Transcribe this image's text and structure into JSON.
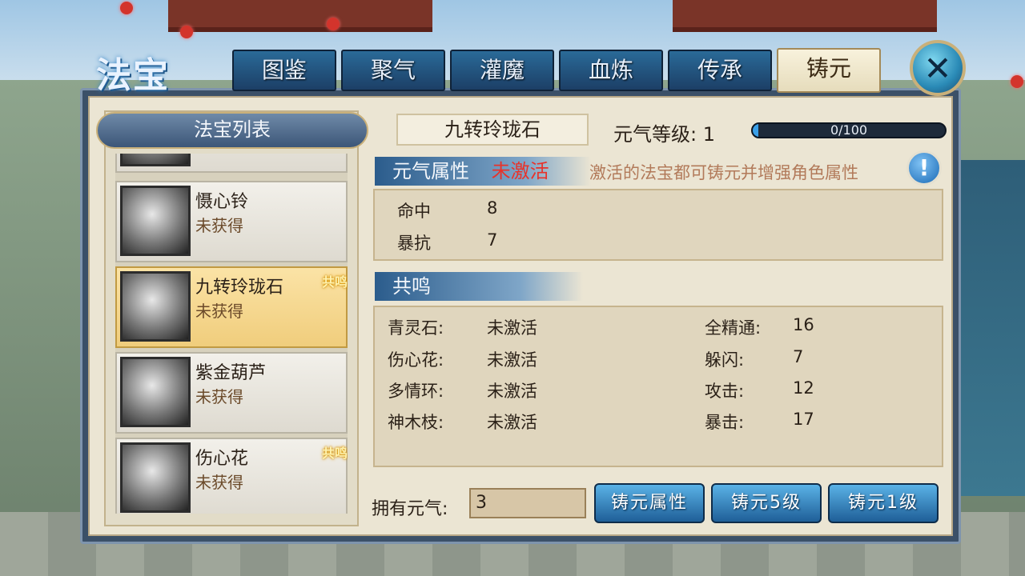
{
  "window": {
    "title": "法宝",
    "close_icon": "close-icon"
  },
  "tabs": [
    {
      "label": "图鉴",
      "active": false
    },
    {
      "label": "聚气",
      "active": false
    },
    {
      "label": "灌魔",
      "active": false
    },
    {
      "label": "血炼",
      "active": false
    },
    {
      "label": "传承",
      "active": false
    },
    {
      "label": "铸元",
      "active": true
    }
  ],
  "list": {
    "header": "法宝列表",
    "items": [
      {
        "name": "",
        "status": "",
        "badge": "",
        "selected": false
      },
      {
        "name": "慑心铃",
        "status": "未获得",
        "badge": "",
        "selected": false
      },
      {
        "name": "九转玲珑石",
        "status": "未获得",
        "badge": "共鸣",
        "selected": true
      },
      {
        "name": "紫金葫芦",
        "status": "未获得",
        "badge": "",
        "selected": false
      },
      {
        "name": "伤心花",
        "status": "未获得",
        "badge": "共鸣",
        "selected": false
      }
    ]
  },
  "detail": {
    "name": "九转玲珑石",
    "level_label": "元气等级: 1",
    "progress_text": "0/100",
    "progress_fraction": 0.03,
    "attr_section": {
      "title": "元气属性",
      "state": "未激活",
      "hint": "激活的法宝都可铸元并增强角色属性",
      "rows": [
        {
          "name": "命中",
          "value": "8"
        },
        {
          "name": "暴抗",
          "value": "7"
        }
      ]
    },
    "resonance_section": {
      "title": "共鸣",
      "left_rows": [
        {
          "name": "青灵石:",
          "state": "未激活"
        },
        {
          "name": "伤心花:",
          "state": "未激活"
        },
        {
          "name": "多情环:",
          "state": "未激活"
        },
        {
          "name": "神木枝:",
          "state": "未激活"
        }
      ],
      "right_rows": [
        {
          "name": "全精通:",
          "value": "16"
        },
        {
          "name": "躲闪:",
          "value": "7"
        },
        {
          "name": "攻击:",
          "value": "12"
        },
        {
          "name": "暴击:",
          "value": "17"
        }
      ]
    }
  },
  "footer": {
    "own_label": "拥有元气:",
    "own_value": "3",
    "buttons": [
      "铸元属性",
      "铸元5级",
      "铸元1级"
    ]
  },
  "colors": {
    "inactive": "#e8322a",
    "accent_blue": "#1f5f98"
  }
}
